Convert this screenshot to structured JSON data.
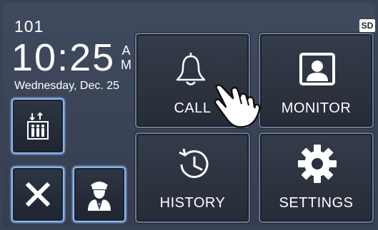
{
  "status": {
    "room": "101",
    "time": "10:25",
    "am": "A",
    "pm": "M",
    "date": "Wednesday, Dec. 25",
    "sd_badge": "SD"
  },
  "tiles": {
    "call": "CALL",
    "monitor": "MONITOR",
    "history": "HISTORY",
    "settings": "SETTINGS"
  },
  "icons": {
    "call": "bell-icon",
    "monitor": "person-portrait-icon",
    "history": "clock-history-icon",
    "settings": "gear-icon",
    "elevator": "elevator-icon",
    "close": "close-icon",
    "guard": "security-guard-icon",
    "pointer": "hand-pointer-icon"
  },
  "colors": {
    "background": "#3a4356",
    "tile_border": "#6b7a92",
    "small_button_glow": "#8fb6e8"
  }
}
